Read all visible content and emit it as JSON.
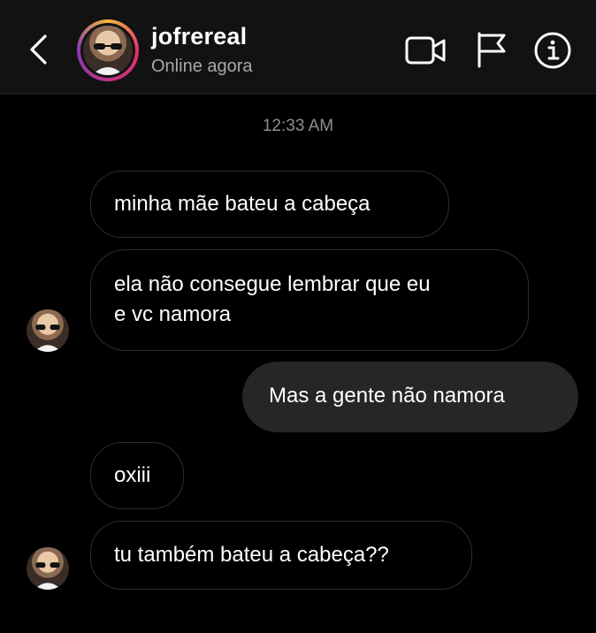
{
  "header": {
    "username": "jofrereal",
    "status": "Online agora"
  },
  "icons": {
    "back": "chevron-left-icon",
    "video": "video-camera-icon",
    "flag": "flag-icon",
    "info": "info-icon"
  },
  "thread": {
    "timestamp": "12:33 AM",
    "messages": [
      {
        "from": "them",
        "text": "minha mãe bateu a cabeça"
      },
      {
        "from": "them",
        "text": "ela não consegue lembrar que eu\ne vc namora"
      },
      {
        "from": "me",
        "text": "Mas a gente não namora"
      },
      {
        "from": "them",
        "text": "oxiii"
      },
      {
        "from": "them",
        "text": "tu também bateu a cabeça??"
      }
    ]
  },
  "colors": {
    "background": "#000000",
    "header": "#121212",
    "sent_bubble": "#262626",
    "received_border": "#2e2e2e"
  }
}
